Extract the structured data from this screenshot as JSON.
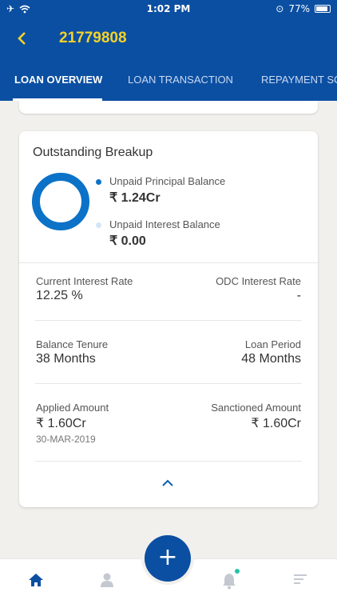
{
  "status_bar": {
    "time": "1:02 PM",
    "battery": "77%"
  },
  "header": {
    "back_icon": "chevron-left-icon",
    "account_number": "21779808"
  },
  "tabs": [
    {
      "label": "LOAN OVERVIEW",
      "active": true
    },
    {
      "label": "LOAN TRANSACTION",
      "active": false
    },
    {
      "label": "REPAYMENT SC",
      "active": false
    }
  ],
  "outstanding": {
    "title": "Outstanding Breakup",
    "principal_label": "Unpaid Principal Balance",
    "principal_value": "₹ 1.24Cr",
    "interest_label": "Unpaid Interest Balance",
    "interest_value": "₹ 0.00",
    "colors": {
      "principal": "#0b72c8",
      "interest": "#d4e6f6"
    }
  },
  "details": {
    "current_interest_rate_label": "Current Interest Rate",
    "current_interest_rate_value": "12.25 %",
    "odc_interest_rate_label": "ODC Interest Rate",
    "odc_interest_rate_value": "-",
    "balance_tenure_label": "Balance Tenure",
    "balance_tenure_value": "38 Months",
    "loan_period_label": "Loan Period",
    "loan_period_value": "48 Months",
    "applied_amount_label": "Applied Amount",
    "applied_amount_value": "₹ 1.60Cr",
    "applied_date": "30-MAR-2019",
    "sanctioned_amount_label": "Sanctioned Amount",
    "sanctioned_amount_value": "₹ 1.60Cr"
  },
  "bottom_nav": {
    "items": [
      "home-icon",
      "profile-icon",
      "bell-icon",
      "menu-icon"
    ],
    "fab_label": "+"
  },
  "colors": {
    "primary": "#0b4fa2",
    "accent": "#f5d22a"
  }
}
